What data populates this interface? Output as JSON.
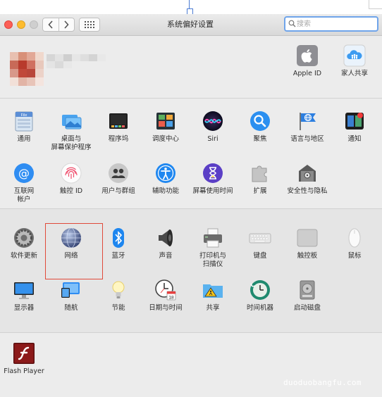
{
  "window": {
    "title": "系统偏好设置"
  },
  "search": {
    "placeholder": "搜索"
  },
  "account": [
    {
      "label": "Apple ID",
      "icon": "apple-logo-icon"
    },
    {
      "label": "家人共享",
      "icon": "family-sharing-icon"
    }
  ],
  "row1": [
    {
      "label": "通用",
      "icon": "general-icon"
    },
    {
      "label": "桌面与\n屏幕保护程序",
      "icon": "desktop-screensaver-icon"
    },
    {
      "label": "程序坞",
      "icon": "dock-icon"
    },
    {
      "label": "调度中心",
      "icon": "mission-control-icon"
    },
    {
      "label": "Siri",
      "icon": "siri-icon"
    },
    {
      "label": "聚焦",
      "icon": "spotlight-icon"
    },
    {
      "label": "语言与地区",
      "icon": "language-region-icon"
    },
    {
      "label": "通知",
      "icon": "notifications-icon"
    }
  ],
  "row2": [
    {
      "label": "互联网\n帐户",
      "icon": "internet-accounts-icon"
    },
    {
      "label": "触控 ID",
      "icon": "touch-id-icon"
    },
    {
      "label": "用户与群组",
      "icon": "users-groups-icon"
    },
    {
      "label": "辅助功能",
      "icon": "accessibility-icon"
    },
    {
      "label": "屏幕使用时间",
      "icon": "screen-time-icon"
    },
    {
      "label": "扩展",
      "icon": "extensions-icon"
    },
    {
      "label": "安全性与隐私",
      "icon": "security-privacy-icon"
    }
  ],
  "row3": [
    {
      "label": "软件更新",
      "icon": "software-update-icon"
    },
    {
      "label": "网络",
      "icon": "network-icon"
    },
    {
      "label": "蓝牙",
      "icon": "bluetooth-icon"
    },
    {
      "label": "声音",
      "icon": "sound-icon"
    },
    {
      "label": "打印机与\n扫描仪",
      "icon": "printers-scanners-icon"
    },
    {
      "label": "键盘",
      "icon": "keyboard-icon"
    },
    {
      "label": "触控板",
      "icon": "trackpad-icon"
    },
    {
      "label": "鼠标",
      "icon": "mouse-icon"
    }
  ],
  "row4": [
    {
      "label": "显示器",
      "icon": "displays-icon"
    },
    {
      "label": "随航",
      "icon": "sidecar-icon"
    },
    {
      "label": "节能",
      "icon": "energy-saver-icon"
    },
    {
      "label": "日期与时间",
      "icon": "date-time-icon"
    },
    {
      "label": "共享",
      "icon": "sharing-icon"
    },
    {
      "label": "时间机器",
      "icon": "time-machine-icon"
    },
    {
      "label": "启动磁盘",
      "icon": "startup-disk-icon"
    }
  ],
  "other": [
    {
      "label": "Flash Player",
      "icon": "flash-player-icon"
    }
  ],
  "date_icon_day": "18",
  "watermark": "duoduobangfu.com",
  "colors": {
    "highlight": "#e04a3a",
    "search_focus": "#6fa4ea",
    "close": "#fc5f57",
    "minimize": "#fdbc2e"
  }
}
